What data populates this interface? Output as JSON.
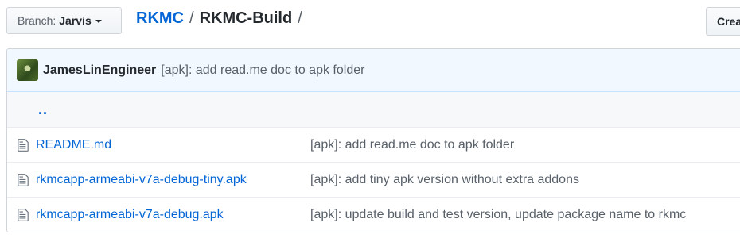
{
  "branch": {
    "prefix": "Branch:",
    "name": "Jarvis"
  },
  "breadcrumb": {
    "owner": "RKMC",
    "separator": "/",
    "repo": "RKMC-Build",
    "trailing": "/"
  },
  "create_button": {
    "label": "Crea"
  },
  "commit": {
    "author": "JamesLinEngineer",
    "message": "[apk]: add read.me doc to apk folder"
  },
  "parent_dir": {
    "label": ".."
  },
  "files": [
    {
      "name": "README.md",
      "message": "[apk]: add read.me doc to apk folder"
    },
    {
      "name": "rkmcapp-armeabi-v7a-debug-tiny.apk",
      "message": "[apk]: add tiny apk version without extra addons"
    },
    {
      "name": "rkmcapp-armeabi-v7a-debug.apk",
      "message": "[apk]: update build and test version, update package name to rkmc"
    }
  ],
  "colors": {
    "link": "#0366d6",
    "text": "#24292e",
    "muted": "#586069",
    "commit_bg": "#f1f8ff"
  }
}
